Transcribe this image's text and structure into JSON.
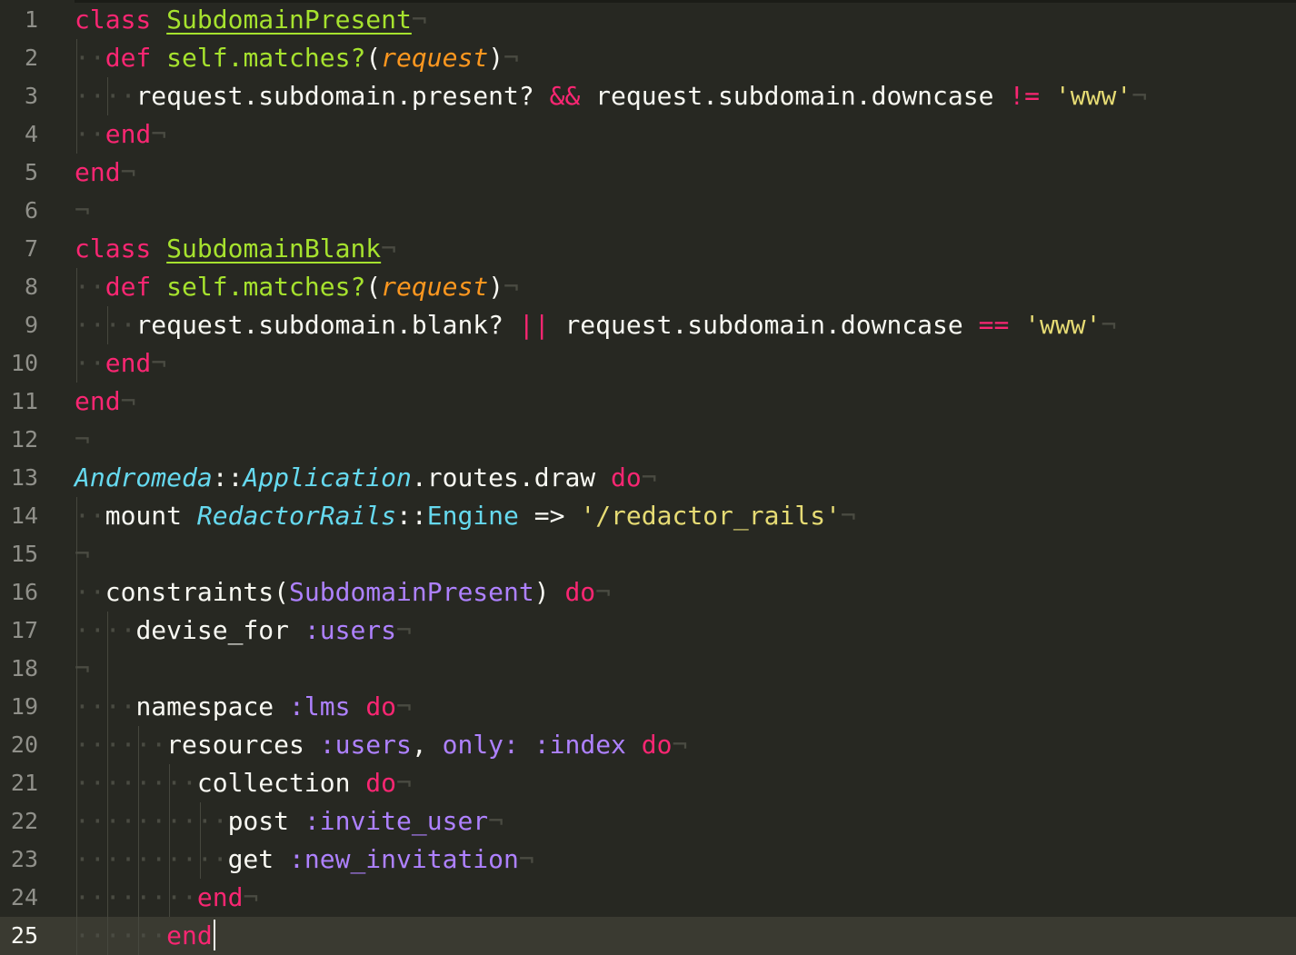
{
  "editor": {
    "pilcrow": "¬",
    "lines": [
      {
        "n": "1"
      },
      {
        "n": "2"
      },
      {
        "n": "3"
      },
      {
        "n": "4"
      },
      {
        "n": "5"
      },
      {
        "n": "6"
      },
      {
        "n": "7"
      },
      {
        "n": "8"
      },
      {
        "n": "9"
      },
      {
        "n": "10"
      },
      {
        "n": "11"
      },
      {
        "n": "12"
      },
      {
        "n": "13"
      },
      {
        "n": "14"
      },
      {
        "n": "15"
      },
      {
        "n": "16"
      },
      {
        "n": "17"
      },
      {
        "n": "18"
      },
      {
        "n": "19"
      },
      {
        "n": "20"
      },
      {
        "n": "21"
      },
      {
        "n": "22"
      },
      {
        "n": "23"
      },
      {
        "n": "24"
      },
      {
        "n": "25"
      }
    ],
    "tokens": {
      "class": "class",
      "def": "def",
      "end": "end",
      "do": "do",
      "subdomain_present": "SubdomainPresent",
      "subdomain_blank": "SubdomainBlank",
      "self_matches": "self.matches?",
      "request_param": "request",
      "paren_open": "(",
      "paren_close": ")",
      "line3_a": "request.subdomain.present? ",
      "and_op": "&&",
      "line3_b": " request.subdomain.downcase ",
      "neq_op": "!=",
      "www": "'www'",
      "line9_a": "request.subdomain.blank? ",
      "or_op": "||",
      "line9_b": " request.subdomain.downcase ",
      "eq_op": "==",
      "andromeda": "Andromeda",
      "scope_op": "::",
      "application": "Application",
      "routes_draw": ".routes.draw ",
      "mount": "mount ",
      "redactor_rails": "RedactorRails",
      "engine": "Engine",
      "arrow": " => ",
      "redactor_path": "'/redactor_rails'",
      "constraints": "constraints(",
      "subdomain_present_arg": "SubdomainPresent",
      "constraints_close": ") ",
      "devise_for": "devise_for ",
      "sym_users": ":users",
      "namespace": "namespace ",
      "sym_lms": ":lms",
      "resources": "resources ",
      "comma": ", ",
      "only": "only:",
      "sym_index": " :index",
      "collection": "collection ",
      "post": "post ",
      "sym_invite_user": ":invite_user",
      "get": "get ",
      "sym_new_invitation": ":new_invitation"
    }
  },
  "colors": {
    "background": "#272822",
    "current_line": "#3a3a31",
    "keyword": "#f92672",
    "class_name": "#a6e22e",
    "parameter": "#fd971f",
    "string": "#e6db74",
    "symbol": "#ae81ff",
    "type": "#66d9ef",
    "text": "#f8f8f2",
    "gutter_text": "#90908a"
  }
}
